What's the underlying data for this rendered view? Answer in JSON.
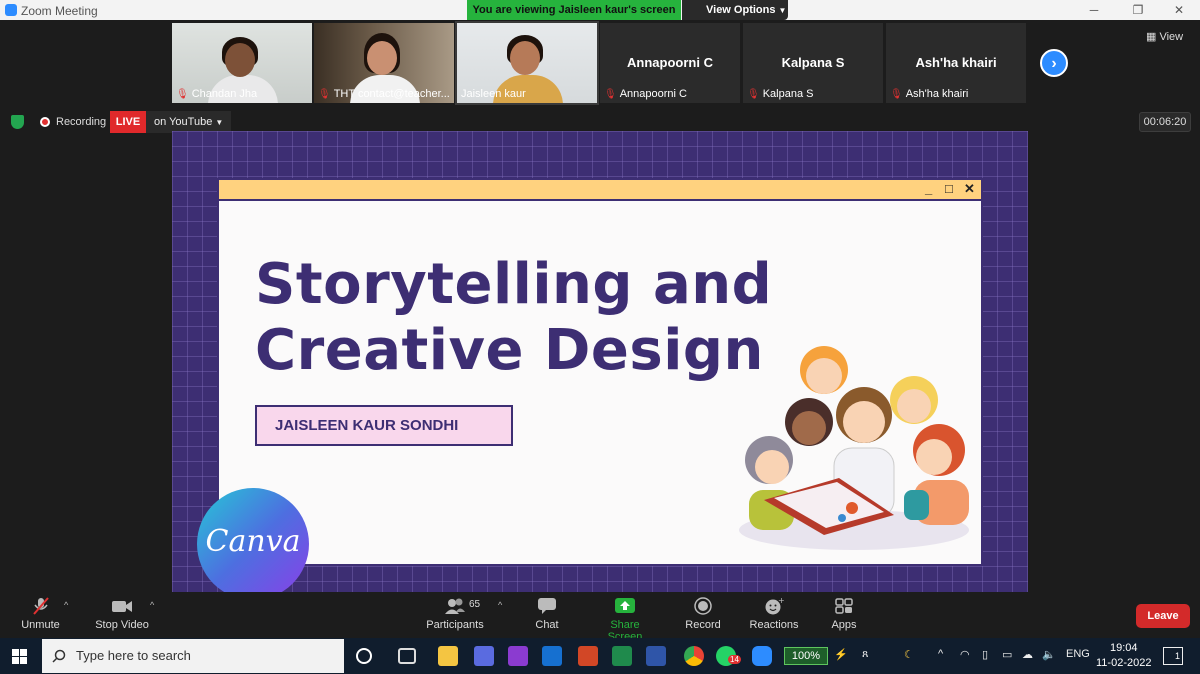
{
  "window": {
    "title": "Zoom Meeting",
    "viewing_banner": "You are viewing Jaisleen kaur's screen",
    "view_options": "View Options"
  },
  "gallery": {
    "view_label": "View",
    "tiles": [
      {
        "label": "Chandan Jha",
        "type": "video"
      },
      {
        "label": "THT contact@teacher...",
        "type": "video"
      },
      {
        "label": "Jaisleen kaur",
        "type": "video"
      },
      {
        "label": "Annapoorni C",
        "big_name": "Annapoorni C",
        "type": "name"
      },
      {
        "label": "Kalpana S",
        "big_name": "Kalpana S",
        "type": "name"
      },
      {
        "label": "Ash'ha khairi",
        "big_name": "Ash'ha khairi",
        "type": "name"
      }
    ]
  },
  "status": {
    "recording": "Recording",
    "live": "LIVE",
    "live_target": "on YouTube",
    "elapsed": "00:06:20"
  },
  "slide": {
    "headline_line1": "Storytelling and",
    "headline_line2": "Creative Design",
    "presenter": "JAISLEEN KAUR SONDHI",
    "badge": "Canva"
  },
  "controls": {
    "unmute": "Unmute",
    "stop_video": "Stop Video",
    "participants": "Participants",
    "participant_count": "65",
    "chat": "Chat",
    "share_screen": "Share Screen",
    "record": "Record",
    "reactions": "Reactions",
    "apps": "Apps",
    "leave": "Leave"
  },
  "taskbar": {
    "search_placeholder": "Type here to search",
    "whatsapp_badge": "14",
    "battery": "100%",
    "language": "ENG",
    "time": "19:04",
    "date": "11-02-2022",
    "notifications": "1"
  },
  "colors": {
    "zoom_blue": "#2d8cff",
    "banner_green": "#26b33d",
    "live_red": "#e0292b",
    "slide_purple": "#3d2e73",
    "slide_yellow": "#ffd27f",
    "slide_pink": "#f9d7ec"
  }
}
